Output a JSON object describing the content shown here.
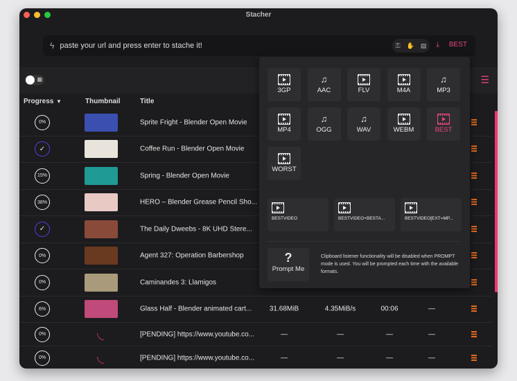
{
  "window": {
    "title": "Stacher"
  },
  "url_bar": {
    "placeholder": "paste your url and press enter to stache it!",
    "format_label": "BEST"
  },
  "table": {
    "headers": [
      "Progress",
      "Thumbnail",
      "Title"
    ],
    "rows": [
      {
        "progress": "0%",
        "state": "pending",
        "title": "Sprite Fright - Blender Open Movie",
        "thumb": "#3a4fb0",
        "size": "",
        "speed": "",
        "eta": "",
        "extra": ""
      },
      {
        "progress": "",
        "state": "done",
        "title": "Coffee Run - Blender Open Movie",
        "thumb": "#e8e4dc",
        "size": "",
        "speed": "",
        "eta": "",
        "extra": ""
      },
      {
        "progress": "15%",
        "state": "downloading",
        "title": "Spring - Blender Open Movie",
        "thumb": "#1f9a95",
        "size": "",
        "speed": "",
        "eta": "",
        "extra": ""
      },
      {
        "progress": "38%",
        "state": "downloading",
        "title": "HERO – Blender Grease Pencil Sho...",
        "thumb": "#e9c9c4",
        "size": "",
        "speed": "",
        "eta": "",
        "extra": ""
      },
      {
        "progress": "",
        "state": "done",
        "title": "The Daily Dweebs - 8K UHD Stere...",
        "thumb": "#8a4a3a",
        "size": "",
        "speed": "",
        "eta": "",
        "extra": ""
      },
      {
        "progress": "0%",
        "state": "pending",
        "title": "Agent 327: Operation Barbershop",
        "thumb": "#6a3a20",
        "size": "",
        "speed": "",
        "eta": "",
        "extra": ""
      },
      {
        "progress": "0%",
        "state": "pending",
        "title": "Caminandes 3: Llamigos",
        "thumb": "#a89a7a",
        "size": "",
        "speed": "",
        "eta": "",
        "extra": ""
      },
      {
        "progress": "6%",
        "state": "downloading",
        "title": "Glass Half - Blender animated cart...",
        "thumb": "#c04a7a",
        "size": "31.68MiB",
        "speed": "4.35MiB/s",
        "eta": "00:06",
        "extra": "—"
      },
      {
        "progress": "0%",
        "state": "queued",
        "title": "[PENDING] https://www.youtube.co...",
        "thumb": "",
        "size": "—",
        "speed": "—",
        "eta": "—",
        "extra": "—"
      },
      {
        "progress": "0%",
        "state": "queued",
        "title": "[PENDING] https://www.youtube.co...",
        "thumb": "",
        "size": "—",
        "speed": "—",
        "eta": "—",
        "extra": "—"
      }
    ]
  },
  "format_popup": {
    "formats": [
      {
        "label": "3GP",
        "icon": "film-icon"
      },
      {
        "label": "AAC",
        "icon": "music-icon"
      },
      {
        "label": "FLV",
        "icon": "film-icon"
      },
      {
        "label": "M4A",
        "icon": "film-icon"
      },
      {
        "label": "MP3",
        "icon": "music-icon"
      },
      {
        "label": "MP4",
        "icon": "film-icon"
      },
      {
        "label": "OGG",
        "icon": "music-icon"
      },
      {
        "label": "WAV",
        "icon": "music-icon"
      },
      {
        "label": "WEBM",
        "icon": "film-icon"
      },
      {
        "label": "BEST",
        "icon": "film-icon",
        "selected": true
      },
      {
        "label": "WORST",
        "icon": "film-icon"
      }
    ],
    "custom": [
      "BESTVIDEO",
      "BESTVIDEO+BESTA...",
      "BESTVIDEO[EXT=MP..."
    ],
    "prompt_label": "Prompt Me",
    "prompt_note": "Clipboard listener functionality will be disabled when PROMPT mode is used. You will be prompted each time with the available formats."
  },
  "colors": {
    "accent": "#e8457c",
    "menu": "#e86a1e",
    "done": "#5a3ddc"
  }
}
